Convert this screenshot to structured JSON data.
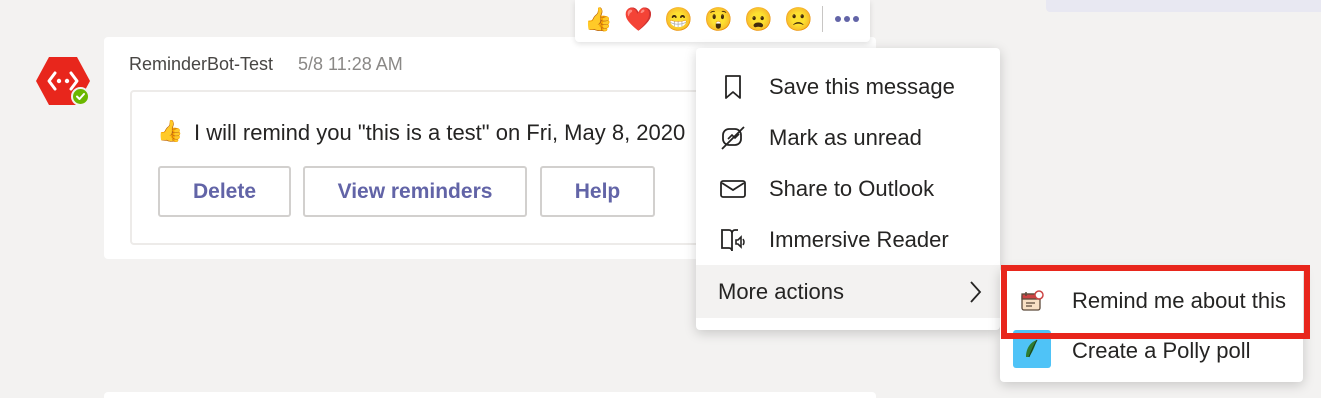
{
  "message": {
    "sender": "ReminderBot-Test",
    "timestamp": "5/8 11:28 AM",
    "card_text": "I will remind you \"this is a test\" on Fri, May 8, 2020",
    "card_emoji": "👍",
    "buttons": {
      "delete": "Delete",
      "view": "View reminders",
      "help": "Help"
    }
  },
  "reactions": [
    {
      "name": "like",
      "glyph": "👍"
    },
    {
      "name": "heart",
      "glyph": "❤️"
    },
    {
      "name": "laugh",
      "glyph": "😁"
    },
    {
      "name": "surprised",
      "glyph": "😲"
    },
    {
      "name": "sad",
      "glyph": "😦"
    },
    {
      "name": "angry",
      "glyph": "🙁"
    }
  ],
  "menu": {
    "save": "Save this message",
    "unread": "Mark as unread",
    "outlook": "Share to Outlook",
    "reader": "Immersive Reader",
    "more": "More actions"
  },
  "submenu": {
    "remind": "Remind me about this",
    "polly": "Create a Polly poll"
  },
  "colors": {
    "accent": "#6264a7",
    "highlight": "#e8261c",
    "avatar": "#e8261c",
    "presence": "#6bb700"
  }
}
